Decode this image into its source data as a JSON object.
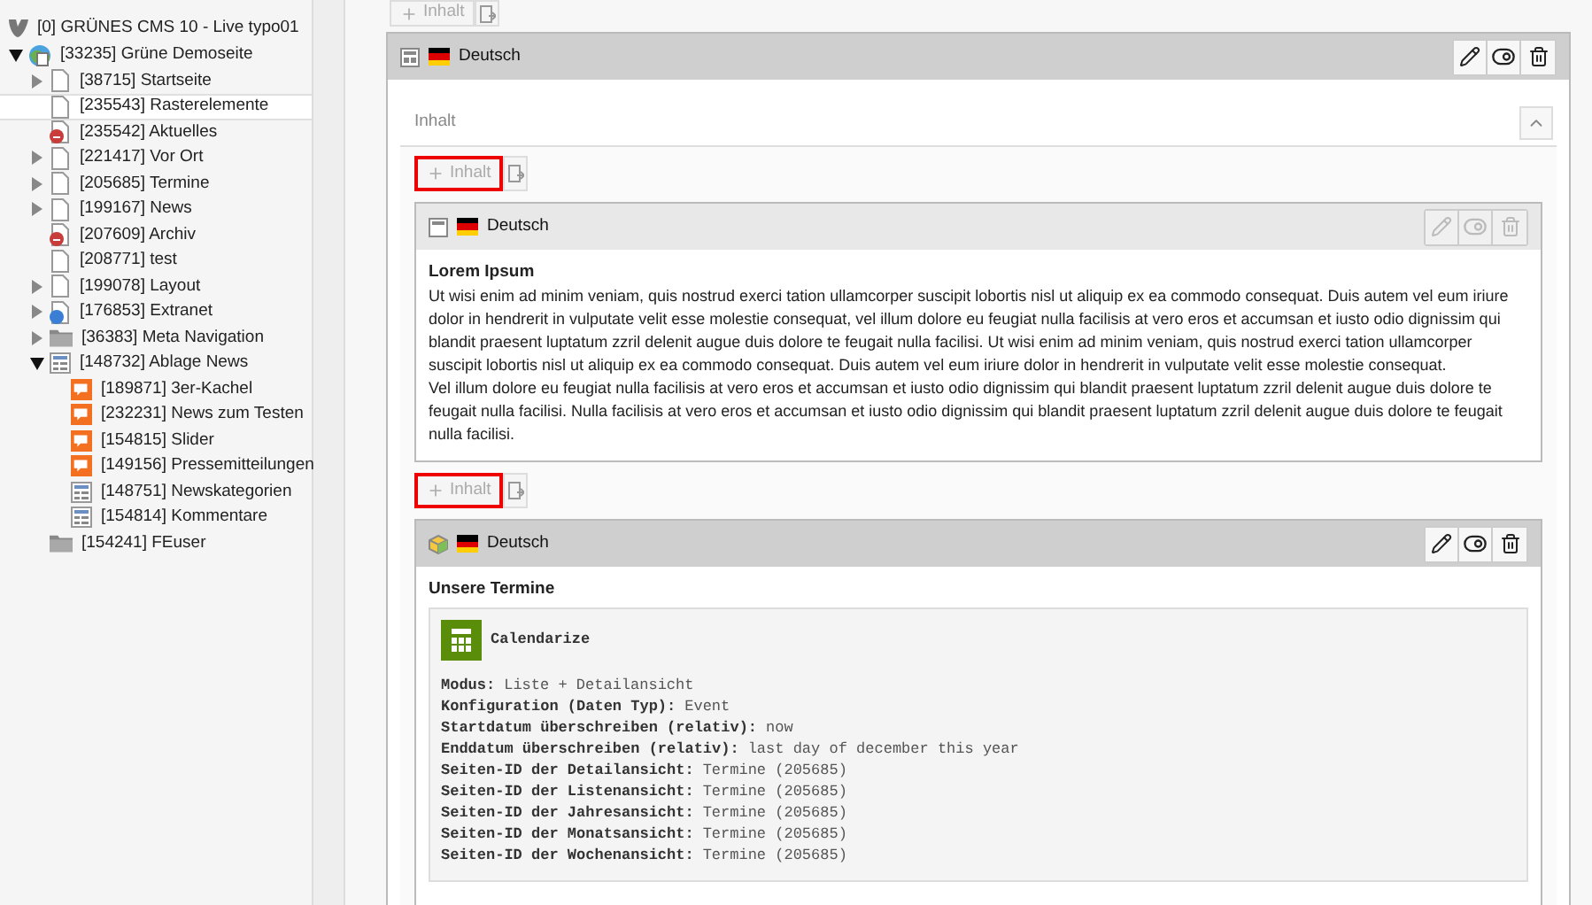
{
  "tree": {
    "root": {
      "label": "[0] GRÜNES CMS 10 - Live typo01"
    },
    "nodes": [
      {
        "label": "[33235] Grüne Demoseite",
        "kind": "site",
        "expanded": true,
        "selected": false,
        "children": [
          {
            "label": "[38715] Startseite",
            "kind": "page",
            "expanded": false,
            "selected": false
          },
          {
            "label": "[235543] Rasterelemente",
            "kind": "page",
            "selected": true
          },
          {
            "label": "[235542] Aktuelles",
            "kind": "hidden",
            "selected": false
          },
          {
            "label": "[221417] Vor Ort",
            "kind": "page",
            "expanded": false,
            "selected": false
          },
          {
            "label": "[205685] Termine",
            "kind": "page",
            "expanded": false,
            "selected": false
          },
          {
            "label": "[199167] News",
            "kind": "page",
            "expanded": false,
            "selected": false
          },
          {
            "label": "[207609] Archiv",
            "kind": "hidden",
            "selected": false
          },
          {
            "label": "[208771] test",
            "kind": "page",
            "selected": false
          },
          {
            "label": "[199078] Layout",
            "kind": "page",
            "expanded": false,
            "selected": false
          },
          {
            "label": "[176853] Extranet",
            "kind": "shortcut",
            "expanded": false,
            "selected": false
          },
          {
            "label": "[36383] Meta Navigation",
            "kind": "folder",
            "expanded": false,
            "selected": false
          },
          {
            "label": "[148732] Ablage News",
            "kind": "list",
            "expanded": true,
            "selected": false,
            "children": [
              {
                "label": "[189871] 3er-Kachel",
                "kind": "news",
                "selected": false
              },
              {
                "label": "[232231] News zum Testen",
                "kind": "news",
                "selected": false
              },
              {
                "label": "[154815] Slider",
                "kind": "news",
                "selected": false
              },
              {
                "label": "[149156] Pressemitteilungen",
                "kind": "news",
                "selected": false
              },
              {
                "label": "[148751] Newskategorien",
                "kind": "list",
                "selected": false
              },
              {
                "label": "[154814] Kommentare",
                "kind": "list",
                "selected": false
              }
            ]
          },
          {
            "label": "[154241] FEuser",
            "kind": "folder",
            "selected": false
          }
        ]
      }
    ]
  },
  "top_add": {
    "label": "Inhalt",
    "highlighted": false
  },
  "container": {
    "language": "Deutsch",
    "column": "Inhalt",
    "items": [
      {
        "kind": "add",
        "label": "Inhalt",
        "highlighted": true
      },
      {
        "kind": "text-element",
        "language": "Deutsch",
        "dimmed": true,
        "title": "Lorem Ipsum",
        "paragraphs": [
          "Ut wisi enim ad minim veniam, quis nostrud exerci tation ullamcorper suscipit lobortis nisl ut aliquip ex ea commodo consequat. Duis autem vel eum iriure dolor in hendrerit in vulputate velit esse molestie consequat, vel illum dolore eu feugiat nulla facilisis at vero eros et accumsan et iusto odio dignissim qui blandit praesent luptatum zzril delenit augue duis dolore te feugait nulla facilisi. Ut wisi enim ad minim veniam, quis nostrud exerci tation ullamcorper suscipit lobortis nisl ut aliquip ex ea commodo consequat. Duis autem vel eum iriure dolor in hendrerit in vulputate velit esse molestie consequat.",
          "Vel illum dolore eu feugiat nulla facilisis at vero eros et accumsan et iusto odio dignissim qui blandit praesent luptatum zzril delenit augue duis dolore te feugait nulla facilisi. Nulla facilisis at vero eros et accumsan et iusto odio dignissim qui blandit praesent luptatum zzril delenit augue duis dolore te feugait nulla facilisi."
        ]
      },
      {
        "kind": "add",
        "label": "Inhalt",
        "highlighted": true
      },
      {
        "kind": "plugin-element",
        "language": "Deutsch",
        "dimmed": false,
        "title": "Unsere Termine",
        "plugin": {
          "name": "Calendarize",
          "fields": [
            {
              "label": "Modus:",
              "value": "Liste + Detailansicht"
            },
            {
              "label": "Konfiguration (Daten Typ):",
              "value": "Event"
            },
            {
              "label": "Startdatum überschreiben (relativ):",
              "value": "now"
            },
            {
              "label": "Enddatum überschreiben (relativ):",
              "value": "last day of december this year"
            },
            {
              "label": "Seiten-ID der Detailansicht:",
              "value": "Termine (205685)"
            },
            {
              "label": "Seiten-ID der Listenansicht:",
              "value": "Termine (205685)"
            },
            {
              "label": "Seiten-ID der Jahresansicht:",
              "value": "Termine (205685)"
            },
            {
              "label": "Seiten-ID der Monatsansicht:",
              "value": "Termine (205685)"
            },
            {
              "label": "Seiten-ID der Wochenansicht:",
              "value": "Termine (205685)"
            }
          ]
        }
      }
    ]
  }
}
